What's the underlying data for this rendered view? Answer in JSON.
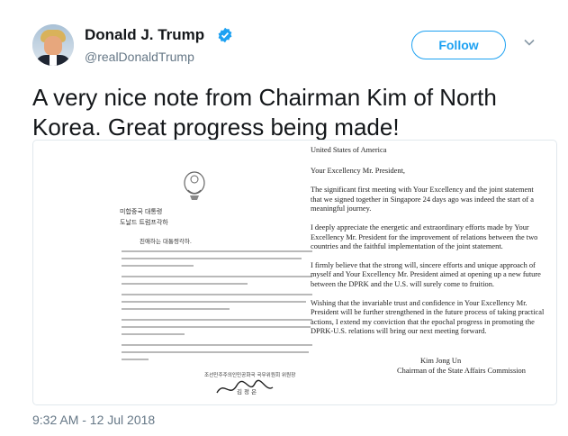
{
  "author": {
    "name": "Donald J. Trump",
    "handle": "@realDonaldTrump",
    "avatar_icon": "profile-photo",
    "verified_icon": "verified-badge-icon"
  },
  "follow_button": {
    "label": "Follow"
  },
  "menu": {
    "icon": "chevron-down-icon"
  },
  "tweet": {
    "text": "A very nice note from Chairman Kim of North Korea. Great progress being made!",
    "timestamp": "9:32 AM - 12 Jul 2018"
  },
  "letter": {
    "korean": {
      "recipient_line1": "미합중국 대통령",
      "recipient_line2": "도날드 트럼프각하",
      "greeting": "친애하는 대통령각하.",
      "signature_title": "조선민주주의인민공화국 국무위원회 위원장",
      "signature_name": "김 정 은"
    },
    "english": {
      "heading": "United States of America",
      "salutation": "Your Excellency Mr. President,",
      "p1": "The significant first meeting with Your Excellency and the joint statement that we signed together in Singapore 24 days ago was indeed the start of a meaningful journey.",
      "p2": "I deeply appreciate the energetic and extraordinary efforts made by Your Excellency Mr. President for the improvement of relations between the two countries and the faithful implementation of the joint statement.",
      "p3": "I firmly believe that the strong will, sincere efforts and unique approach of myself and Your Excellency Mr. President aimed at opening up a new future between the DPRK and the U.S. will surely come to fruition.",
      "p4": "Wishing that the invariable trust and confidence in Your Excellency Mr. President will be further strengthened in the future process of taking practical actions, I extend my conviction that the epochal progress in promoting the DPRK-U.S. relations will bring our next meeting forward.",
      "signer": "Kim Jong Un",
      "signer_title": "Chairman of the State Affairs Commission"
    }
  },
  "colors": {
    "accent": "#1da1f2",
    "muted": "#657786",
    "text": "#14171a"
  }
}
